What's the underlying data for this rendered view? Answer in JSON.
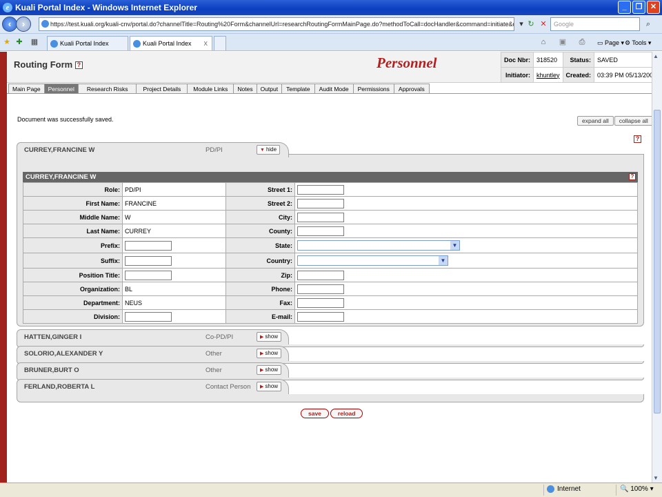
{
  "window": {
    "title": "Kuali Portal Index - Windows Internet Explorer",
    "controls": [
      "_",
      "❐",
      "✕"
    ]
  },
  "address_bar": {
    "url": "https://test.kuali.org/kuali-cnv/portal.do?channelTitle=Routing%20Form&channelUrl=researchRoutingFormMainPage.do?methodToCall=docHandler&command=initiate&docTypeName=KualiRoutingFormDoc",
    "search_placeholder": "Google"
  },
  "browser_tabs": [
    {
      "label": "Kuali Portal Index",
      "active": false
    },
    {
      "label": "Kuali Portal Index",
      "active": true
    }
  ],
  "command_bar": {
    "page": "Page",
    "tools": "Tools"
  },
  "header": {
    "title": "Routing Form",
    "section_title": "Personnel",
    "doc_nbr_label": "Doc Nbr:",
    "doc_nbr": "318520",
    "status_label": "Status:",
    "status": "SAVED",
    "initiator_label": "Initiator:",
    "initiator": "khuntley",
    "created_label": "Created:",
    "created": "03:39 PM 05/13/2008"
  },
  "tabs": [
    "Main Page",
    "Personnel",
    "Research Risks",
    "Project Details",
    "Module Links",
    "Notes",
    "Output",
    "Template",
    "Audit Mode",
    "Permissions",
    "Approvals"
  ],
  "message": "Document was successfully saved.",
  "expand_all": "expand all",
  "collapse_all": "collapse all",
  "help": "?",
  "people": [
    {
      "name": "CURREY,FRANCINE W",
      "role": "PD/PI",
      "toggle": "hide"
    },
    {
      "name": "HATTEN,GINGER I",
      "role": "Co-PD/PI",
      "toggle": "show"
    },
    {
      "name": "SOLORIO,ALEXANDER Y",
      "role": "Other",
      "toggle": "show"
    },
    {
      "name": "BRUNER,BURT O",
      "role": "Other",
      "toggle": "show"
    },
    {
      "name": "FERLAND,ROBERTA L",
      "role": "Contact Person",
      "toggle": "show"
    }
  ],
  "detail": {
    "heading": "CURREY,FRANCINE W",
    "left_labels": [
      "Role:",
      "First Name:",
      "Middle Name:",
      "Last Name:",
      "Prefix:",
      "Suffix:",
      "Position Title:",
      "Organization:",
      "Department:",
      "Division:"
    ],
    "left_values": [
      "PD/PI",
      "FRANCINE",
      "W",
      "CURREY",
      "",
      "",
      "",
      "BL",
      "NEUS",
      ""
    ],
    "right_labels": [
      "Street 1:",
      "Street 2:",
      "City:",
      "County:",
      "State:",
      "Country:",
      "Zip:",
      "Phone:",
      "Fax:",
      "E-mail:"
    ]
  },
  "buttons": {
    "save": "save",
    "reload": "reload"
  },
  "statusbar": {
    "zone": "Internet",
    "zoom": "100%"
  }
}
